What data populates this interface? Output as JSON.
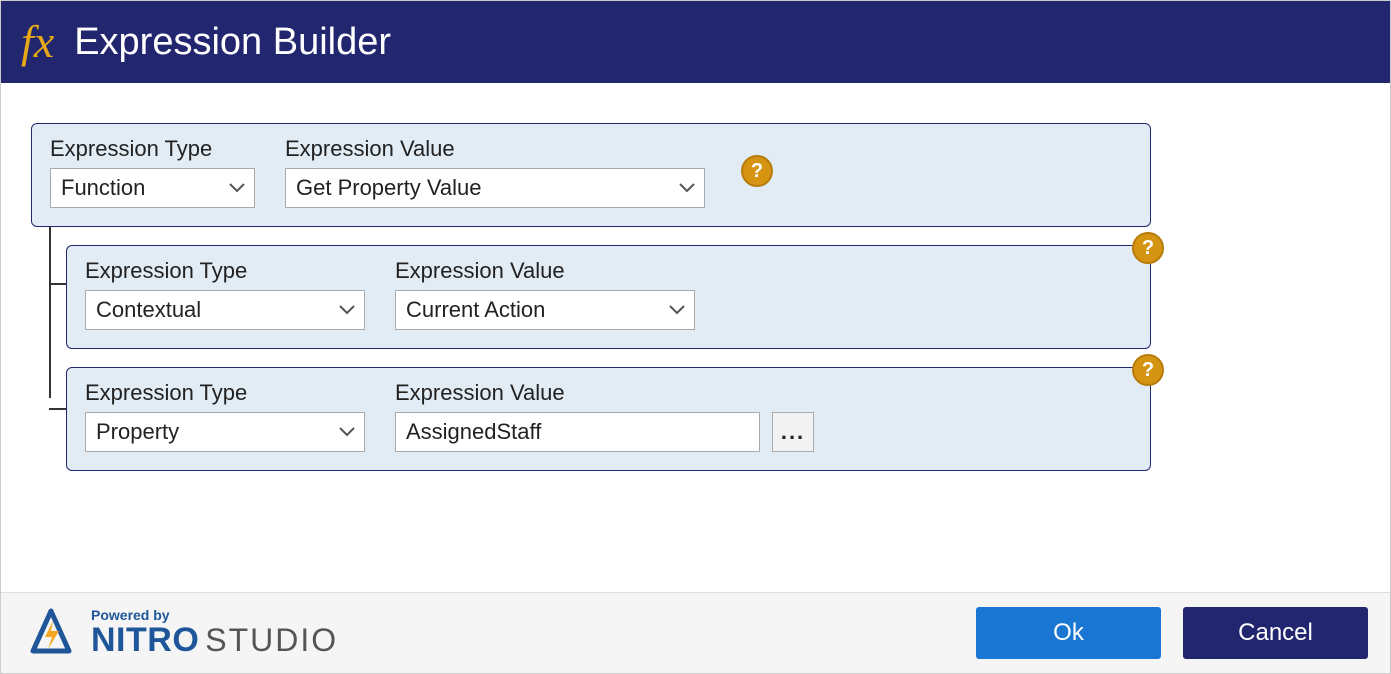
{
  "header": {
    "icon": "fx",
    "title": "Expression Builder"
  },
  "labels": {
    "expression_type": "Expression Type",
    "expression_value": "Expression Value"
  },
  "root": {
    "type": "Function",
    "value": "Get Property Value"
  },
  "children": [
    {
      "type": "Contextual",
      "value": "Current Action"
    },
    {
      "type": "Property",
      "value": "AssignedStaff",
      "has_more": true
    }
  ],
  "footer": {
    "brand_powered": "Powered by",
    "brand_nitro": "NITRO",
    "brand_studio": "STUDIO",
    "ok": "Ok",
    "cancel": "Cancel"
  }
}
